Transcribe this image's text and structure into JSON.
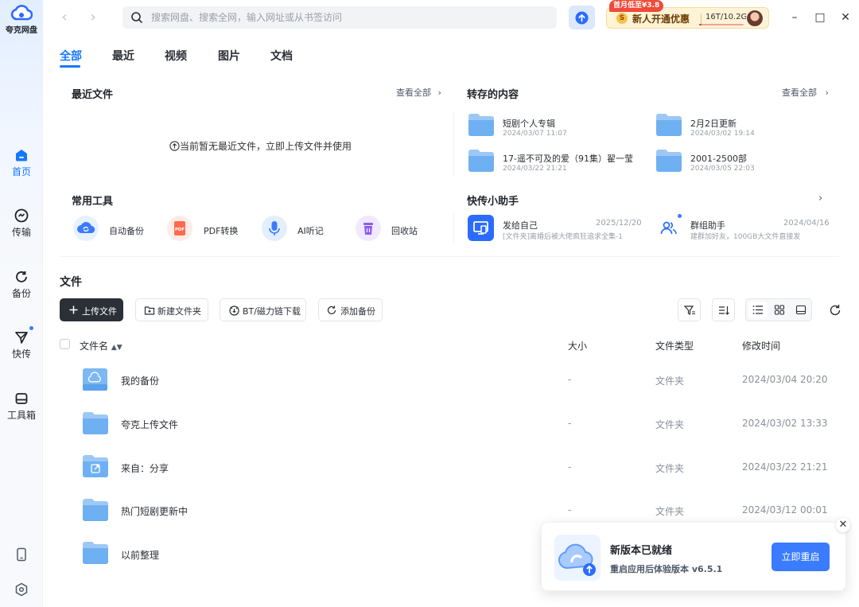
{
  "app": {
    "logo_text": "夸克网盘"
  },
  "rail": {
    "items": [
      {
        "label": "首页"
      },
      {
        "label": "传输"
      },
      {
        "label": "备份"
      },
      {
        "label": "快传"
      },
      {
        "label": "工具箱"
      }
    ]
  },
  "titlebar": {
    "back": "‹",
    "forward": "›",
    "search_placeholder": "搜索网盘、搜索全网，输入网址或从书签访问",
    "promo_tag": "首月低至¥3.8",
    "promo_coin": "S",
    "promo_text": "新人开通优惠",
    "usage": "16T/10.2G",
    "usage_fraction": 0.05,
    "minimize": "–",
    "maximize": "□",
    "close": "✕"
  },
  "tabs": [
    "全部",
    "最近",
    "视频",
    "图片",
    "文档"
  ],
  "recent": {
    "title": "最近文件",
    "see_all": "查看全部",
    "empty": "当前暂无最近文件，立即上传文件并使用"
  },
  "saved": {
    "title": "转存的内容",
    "see_all": "查看全部",
    "items": [
      {
        "name": "短剧个人专辑",
        "time": "2024/03/07 11:07"
      },
      {
        "name": "2月2日更新",
        "time": "2024/03/02 19:14"
      },
      {
        "name": "17-遥不可及的爱（91集）翟一莹",
        "time": "2024/03/22 21:21"
      },
      {
        "name": "2001-2500部",
        "time": "2024/03/05 22:03"
      }
    ]
  },
  "tools": {
    "title": "常用工具",
    "items": [
      {
        "label": "自动备份"
      },
      {
        "label": "PDF转换",
        "badge": "PDF"
      },
      {
        "label": "AI听记"
      },
      {
        "label": "回收站"
      }
    ]
  },
  "quick": {
    "title": "快传小助手",
    "items": [
      {
        "name": "发给自己",
        "date": "2025/12/20",
        "desc": "[文件夹]离婚后被大佬疯狂追求全集-1"
      },
      {
        "name": "群组助手",
        "date": "2024/04/16",
        "desc": "建群加好友，100GB大文件直接发"
      }
    ]
  },
  "files": {
    "title": "文件",
    "buttons": {
      "upload": "上传文件",
      "new_folder": "新建文件夹",
      "bt": "BT/磁力链下载",
      "backup": "添加备份"
    },
    "columns": {
      "name": "文件名",
      "size": "大小",
      "type": "文件类型",
      "modified": "修改时间"
    },
    "rows": [
      {
        "name": "我的备份",
        "size": "-",
        "type": "文件夹",
        "modified": "2024/03/04 20:20"
      },
      {
        "name": "夸克上传文件",
        "size": "-",
        "type": "文件夹",
        "modified": "2024/03/02 13:33"
      },
      {
        "name": "来自：分享",
        "size": "-",
        "type": "文件夹",
        "modified": "2024/03/22 21:21"
      },
      {
        "name": "热门短剧更新中",
        "size": "-",
        "type": "文件夹",
        "modified": "2024/03/12 00:01"
      },
      {
        "name": "以前整理"
      }
    ]
  },
  "toast": {
    "title": "新版本已就绪",
    "subtitle": "重启应用后体验版本 v6.5.1",
    "button": "立即重启",
    "close": "✕"
  }
}
